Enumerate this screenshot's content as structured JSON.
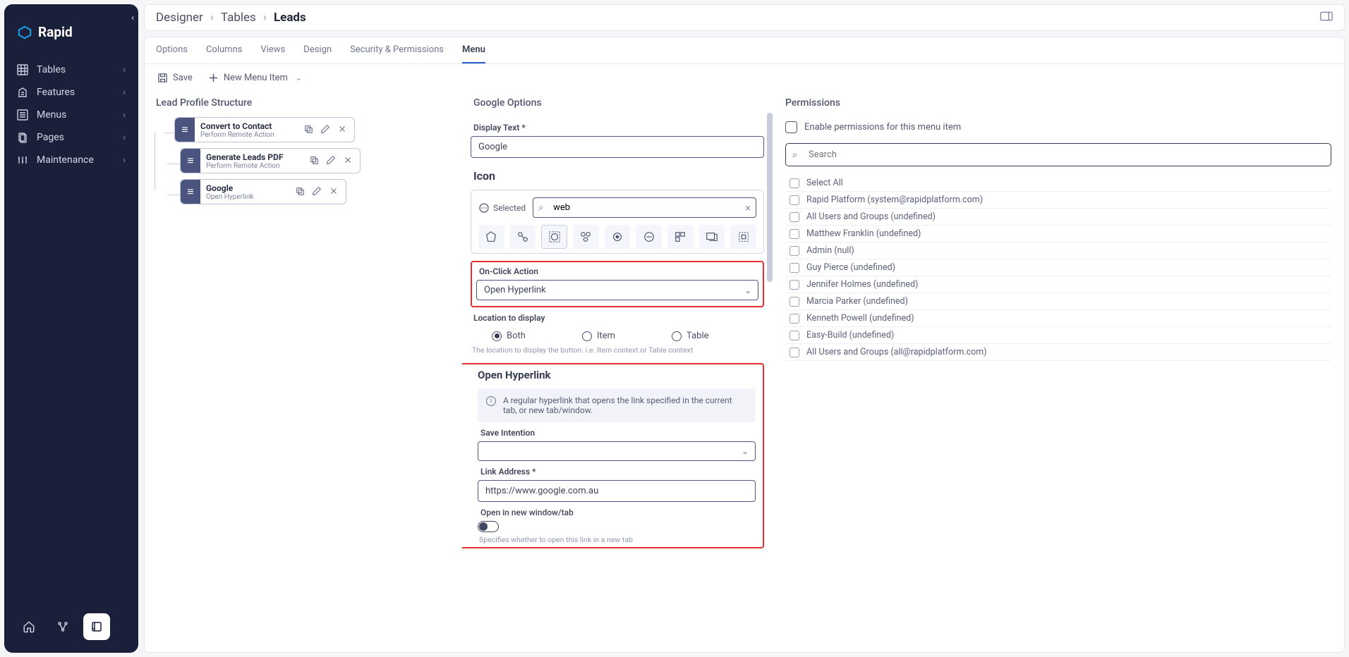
{
  "brand": {
    "name": "Rapid"
  },
  "sidebar": {
    "items": [
      {
        "label": "Tables"
      },
      {
        "label": "Features"
      },
      {
        "label": "Menus"
      },
      {
        "label": "Pages"
      },
      {
        "label": "Maintenance"
      }
    ]
  },
  "breadcrumb": {
    "a": "Designer",
    "b": "Tables",
    "c": "Leads"
  },
  "tabs": [
    {
      "label": "Options"
    },
    {
      "label": "Columns"
    },
    {
      "label": "Views"
    },
    {
      "label": "Design"
    },
    {
      "label": "Security & Permissions"
    },
    {
      "label": "Menu"
    }
  ],
  "toolbar": {
    "save": "Save",
    "new_item": "New Menu Item"
  },
  "structure": {
    "title": "Lead Profile Structure",
    "items": [
      {
        "title": "Convert to Contact",
        "sub": "Perform Remote Action"
      },
      {
        "title": "Generate Leads PDF",
        "sub": "Perform Remote Action"
      },
      {
        "title": "Google",
        "sub": "Open Hyperlink"
      }
    ]
  },
  "options": {
    "title": "Google Options",
    "display_text_label": "Display Text *",
    "display_text_value": "Google",
    "icon_heading": "Icon",
    "icon_selected_label": "Selected",
    "icon_search_value": "web",
    "on_click_label": "On-Click Action",
    "on_click_value": "Open Hyperlink",
    "location_label": "Location to display",
    "location_options": {
      "both": "Both",
      "item": "Item",
      "table": "Table"
    },
    "location_hint": "The location to display the button. i.e. Item context or Table context",
    "open_hyperlink_heading": "Open Hyperlink",
    "open_hyperlink_info": "A regular hyperlink that opens the link specified in the current tab, or new tab/window.",
    "save_intention_label": "Save Intention",
    "save_intention_value": "",
    "link_address_label": "Link Address *",
    "link_address_value": "https://www.google.com.au",
    "open_new_tab_label": "Open in new window/tab",
    "open_new_tab_hint": "Specifies whether to open this link in a new tab"
  },
  "permissions": {
    "title": "Permissions",
    "enable_label": "Enable permissions for this menu item",
    "search_placeholder": "Search",
    "select_all": "Select All",
    "list": [
      "Rapid Platform (system@rapidplatform.com)",
      "All Users and Groups (undefined)",
      "Matthew Franklin (undefined)",
      "Admin (null)",
      "Guy Pierce (undefined)",
      "Jennifer Holmes (undefined)",
      "Marcia Parker (undefined)",
      "Kenneth Powell (undefined)",
      "Easy-Build (undefined)",
      "All Users and Groups (all@rapidplatform.com)"
    ]
  }
}
